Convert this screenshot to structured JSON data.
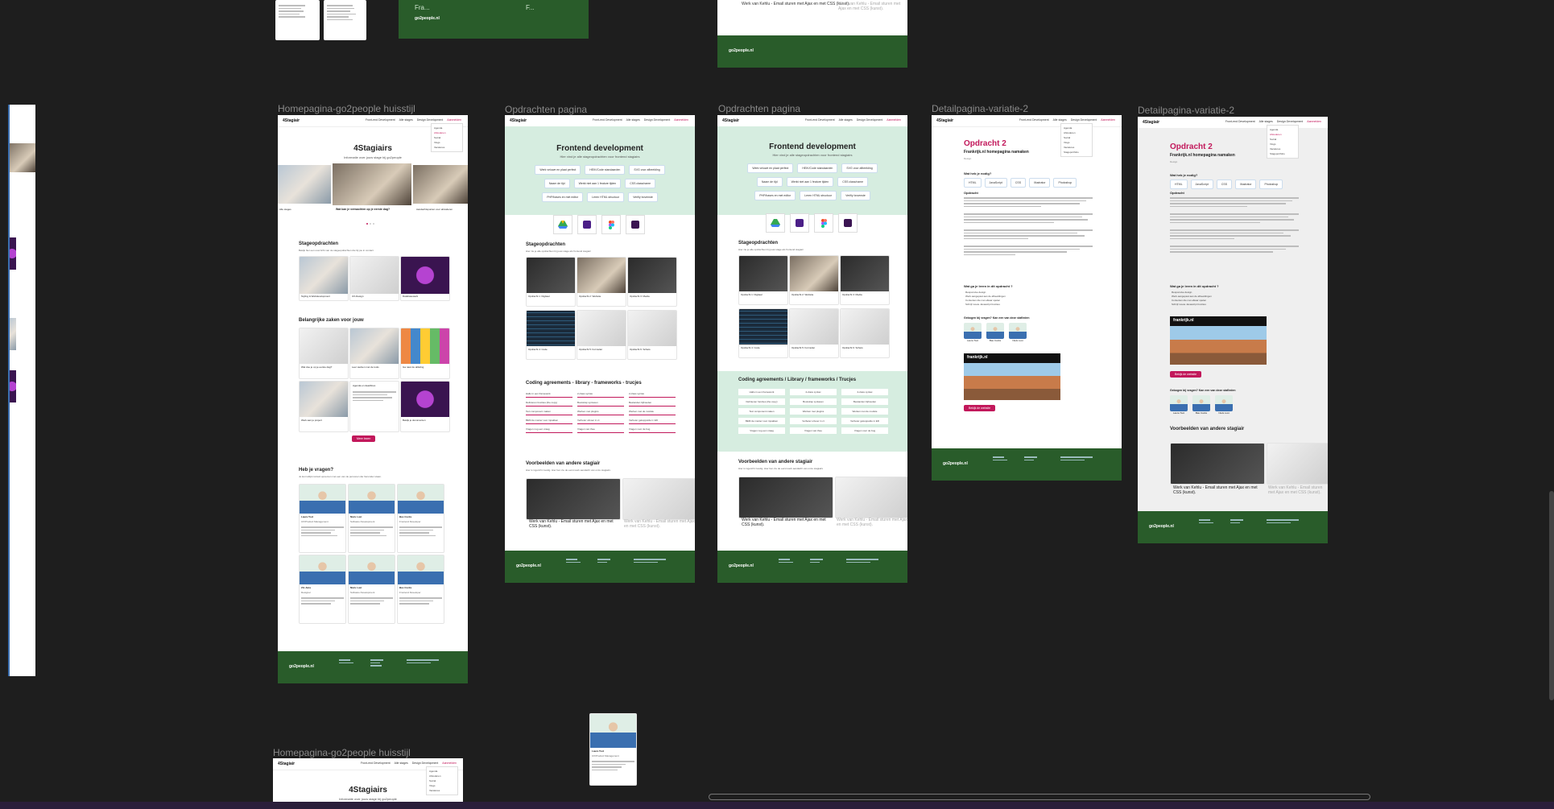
{
  "frames": {
    "homepage_label": "Homepagina-go2people huisstijl",
    "opdrachten1_label": "Opdrachten pagina",
    "opdrachten2_label": "Opdrachten pagina",
    "detail1_label": "Detailpagina-variatie-2",
    "detail2_label": "Detailpagina-variatie-2",
    "homepage_bottom_label": "Homepagina-go2people huisstijl"
  },
  "top_fragments": {
    "green_title": "Fra...",
    "green_brand": "go2people.nl",
    "green_f": "F...",
    "kahla_text": "Werk van Kehlu - Email sturen met Ajax en met CSS (kunst).",
    "kahla_text_faded": "Werk van Kehlu - Email sturen met Ajax en met CSS (kunst)."
  },
  "nav": {
    "logo": "4Stagiair",
    "links": [
      "Front-end Development",
      "Alle stages",
      "Design Development",
      "Aanmelden"
    ],
    "dropdown": [
      "Agenda",
      "Afstuderen",
      "Social",
      "Vlogs",
      "Vacatures",
      "Stageportfolio"
    ]
  },
  "homepage": {
    "hero_title": "4Stagiairs",
    "hero_sub": "Informatie over jouw stage bij go2people",
    "carousel_items": [
      "Wat kan je verwachten op je eerste dag?",
      "Aandachtspunten voor afstuderen",
      "Alle stages"
    ],
    "section_stageopdrachten": "Stageopdrachten",
    "section_stageopdrachten_sub": "Bekijk hier een overzicht van de stageopdrachten die bij jou in contact",
    "stage_cards": [
      "Styling & Webdevelopment",
      "UX-Design",
      "Databasewerk"
    ],
    "section_belangrijk": "Belangrijke zaken voor jouw",
    "belangrijk_cards": [
      "Wat doe je op je eerste dag?",
      "Leer werken met de tools",
      "Ga naar de afdeling",
      "Werk aan je project",
      "Agenda en deadlines",
      "Bekijk je documenten"
    ],
    "belangrijk_button": "Meer lezen",
    "section_vragen": "Heb je vragen?",
    "section_vragen_sub": "Je kunt altijd contact opnemen met een van de personen die hieronder staan.",
    "people": [
      {
        "name": "Laura Tool",
        "role": "UX/Product Management"
      },
      {
        "name": "Niels Lust",
        "role": "Software Development"
      },
      {
        "name": "Bas Cocks",
        "role": "Frontend Developer"
      },
      {
        "name": "Zin Jans",
        "role": "Designer"
      },
      {
        "name": "Niels Lust",
        "role": "Software Development"
      },
      {
        "name": "Bas Cocks",
        "role": "Frontend Developer"
      }
    ],
    "footer_brand": "go2people.nl"
  },
  "opdrachten": {
    "hero_title": "Frontend development",
    "hero_sub": "Hier vind je alle stageopdrachten voor frontend stagiairs",
    "chips": [
      "Werk veiuwe en plaat perfect",
      "HEIK/Code standaarden",
      "SVG voor afbeelding",
      "Naam de tijd",
      "Werkt niet aan 1 feature tijden",
      "CSS class/name",
      "PHP/bases en met editor",
      "Leren HTML structuur",
      "Verifiy bovenste"
    ],
    "tools": [
      "Google Drive",
      "Visual Studio Code",
      "Figma",
      "Terminal"
    ],
    "section_stageopdrachten": "Stageopdrachten",
    "section_stageopdrachten_sub": "Hier zie je alle opdrachten bij jouw stage als frontend stagiair",
    "card_titles": [
      "Opdracht 1: Digitaal",
      "Opdracht 2: Website",
      "Opdracht 3: Media",
      "Opdracht 4: Code",
      "Opdracht 5: Formulier",
      "Opdracht 6: Schets"
    ],
    "section_coding": "Coding agreements - library - frameworks - trucjes",
    "section_coding_alt": "Coding agreements / Library / frameworks / Trucjes",
    "coding_items": [
      "Hallo in een framework",
      "2-class syntax",
      "2-class syntax",
      "Definieren functies (the copy)",
      "Bootstrap syntaxen",
      "Bestanden bijhouden",
      "Text component maken",
      "Werken met plugins",
      "Werken met de module",
      "BEM de manier voor inpakken",
      "Verbeter uitvoer in ct",
      "Verbeter gekoppelde in ED",
      "Vragen nog een vraag",
      "Vragen van thee",
      "Vragen voor de bug"
    ],
    "section_voorbeelden": "Voorbeelden van andere stagiair",
    "section_voorbeelden_sub": "Hier is ingericht zoodig. Hier ben zie de eerst werk aandacht van onze stagiairs",
    "voorbeeld_text": "Werk van Kehlu - Email sturen met Ajax en met CSS (kunst).",
    "voorbeeld_text_faded": "Werk van Kehlu - Email sturen met Ajax en met CSS (kunst).",
    "footer_brand": "go2people.nl"
  },
  "detail": {
    "title": "Opdracht 2",
    "subtitle": "Frankrijk.nl homepagina namaken",
    "tag": "Design",
    "tools_label": "Wat heb je nodig?",
    "tools": [
      "HTML",
      "JavaScript",
      "CSS",
      "Illustrator",
      "Photoshop"
    ],
    "section_opdracht": "Opdracht",
    "section_leren": "Wat ga je leren in dit opdracht ?",
    "leren_items": [
      "Responsive design",
      "Werk aangepast aan de afbeeldingen",
      "Contenten die met elkaar spelen",
      "Schrijf mooie Javascript functies"
    ],
    "section_contact": "Gebogen bij vragen? Kan een van deze stafleden",
    "people": [
      "Laura Tool",
      "Bas Cocks",
      "Niels Lust"
    ],
    "preview_brand": "frankrijk.nl",
    "preview_button": "Bekijk de website",
    "section_voorbeelden": "Voorbeelden van andere stagiair",
    "voorbeeld_text": "Werk van Kehlu - Email sturen met Ajax en met CSS (kunst).",
    "voorbeeld_text_faded": "Werk van Kehlu - Email sturen met Ajax en met CSS (kunst).",
    "footer_brand": "go2people.nl"
  },
  "floating_person": {
    "name": "Laura Tool",
    "role": "UX/Product Management"
  },
  "bottom_home": {
    "hero_title": "4Stagiairs",
    "hero_sub": "Informatie over jouw stage bij go2people"
  },
  "colors": {
    "canvas": "#1e1e1e",
    "accent": "#c2185b",
    "brand_green": "#295c2a",
    "mint": "#d6ede0"
  }
}
